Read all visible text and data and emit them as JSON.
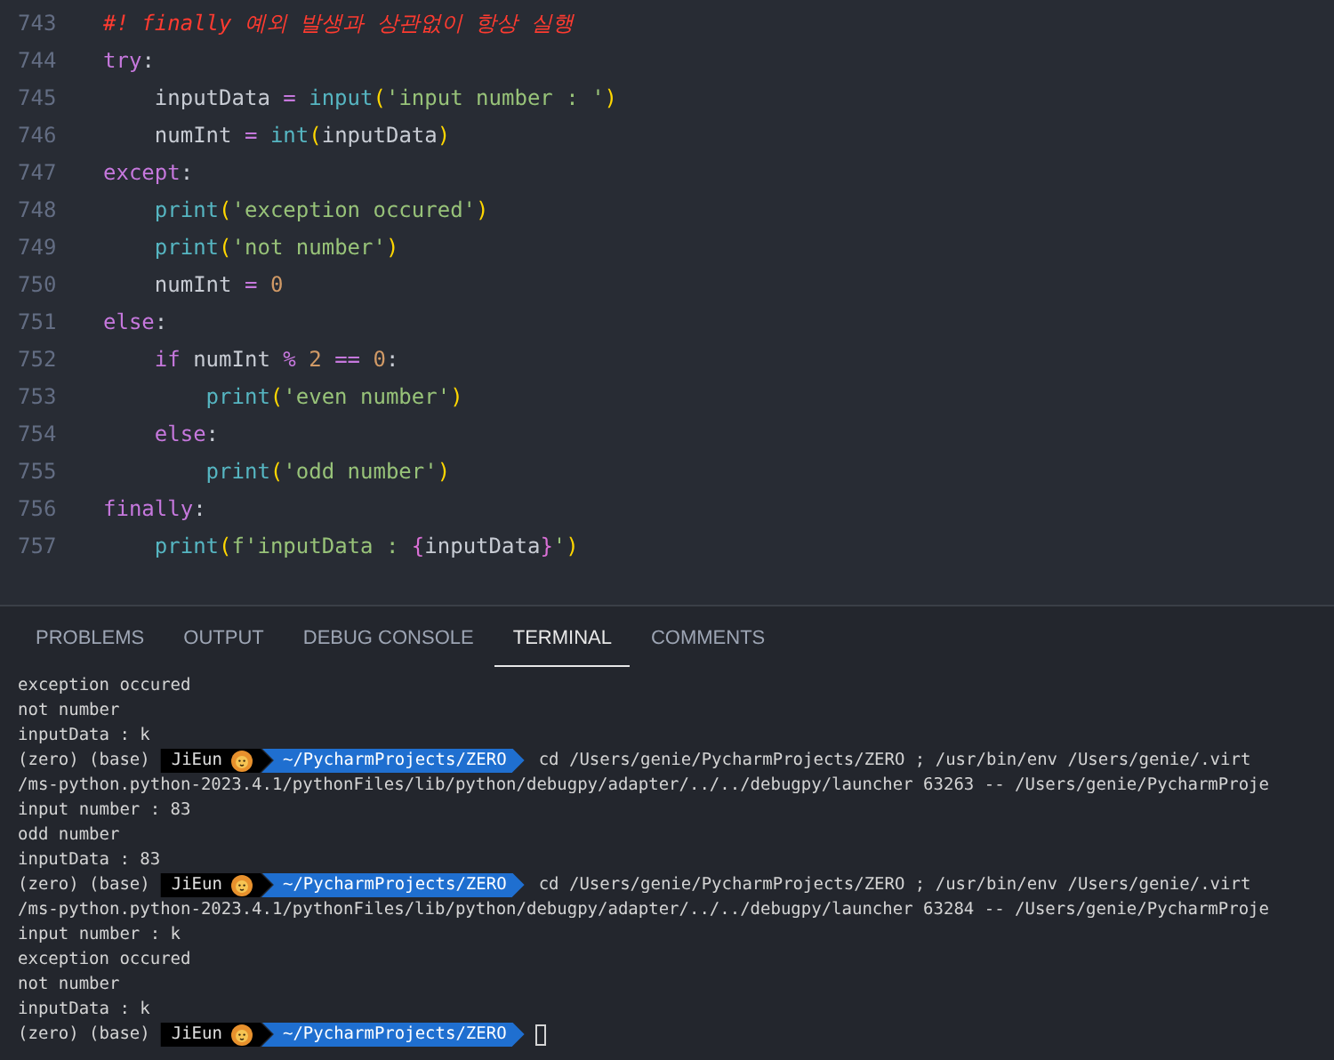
{
  "editor": {
    "lines": [
      {
        "number": "743",
        "tokens": [
          {
            "kind": "comment",
            "text": "#! finally 예외 발생과 상관없이 항상 실행"
          }
        ]
      },
      {
        "number": "744",
        "tokens": [
          {
            "kind": "keyword",
            "text": "try"
          },
          {
            "kind": "plain",
            "text": ":"
          }
        ]
      },
      {
        "number": "745",
        "tokens": [
          {
            "kind": "plain",
            "text": "    inputData "
          },
          {
            "kind": "operator",
            "text": "= "
          },
          {
            "kind": "function",
            "text": "input"
          },
          {
            "kind": "paren",
            "text": "("
          },
          {
            "kind": "string",
            "text": "'input number : '"
          },
          {
            "kind": "paren",
            "text": ")"
          }
        ]
      },
      {
        "number": "746",
        "tokens": [
          {
            "kind": "plain",
            "text": "    numInt "
          },
          {
            "kind": "operator",
            "text": "= "
          },
          {
            "kind": "function",
            "text": "int"
          },
          {
            "kind": "paren",
            "text": "("
          },
          {
            "kind": "plain",
            "text": "inputData"
          },
          {
            "kind": "paren",
            "text": ")"
          }
        ]
      },
      {
        "number": "747",
        "tokens": [
          {
            "kind": "keyword",
            "text": "except"
          },
          {
            "kind": "plain",
            "text": ":"
          }
        ]
      },
      {
        "number": "748",
        "tokens": [
          {
            "kind": "function",
            "text": "    print"
          },
          {
            "kind": "paren",
            "text": "("
          },
          {
            "kind": "string",
            "text": "'exception occured'"
          },
          {
            "kind": "paren",
            "text": ")"
          }
        ]
      },
      {
        "number": "749",
        "tokens": [
          {
            "kind": "function",
            "text": "    print"
          },
          {
            "kind": "paren",
            "text": "("
          },
          {
            "kind": "string",
            "text": "'not number'"
          },
          {
            "kind": "paren",
            "text": ")"
          }
        ]
      },
      {
        "number": "750",
        "tokens": [
          {
            "kind": "plain",
            "text": "    numInt "
          },
          {
            "kind": "operator",
            "text": "= "
          },
          {
            "kind": "number",
            "text": "0"
          }
        ]
      },
      {
        "number": "751",
        "tokens": [
          {
            "kind": "keyword",
            "text": "else"
          },
          {
            "kind": "plain",
            "text": ":"
          }
        ]
      },
      {
        "number": "752",
        "tokens": [
          {
            "kind": "keyword",
            "text": "    if"
          },
          {
            "kind": "plain",
            "text": " numInt "
          },
          {
            "kind": "operator",
            "text": "% "
          },
          {
            "kind": "number",
            "text": "2 "
          },
          {
            "kind": "operator",
            "text": "== "
          },
          {
            "kind": "number",
            "text": "0"
          },
          {
            "kind": "plain",
            "text": ":"
          }
        ]
      },
      {
        "number": "753",
        "tokens": [
          {
            "kind": "function",
            "text": "        print"
          },
          {
            "kind": "paren",
            "text": "("
          },
          {
            "kind": "string",
            "text": "'even number'"
          },
          {
            "kind": "paren",
            "text": ")"
          }
        ]
      },
      {
        "number": "754",
        "tokens": [
          {
            "kind": "keyword",
            "text": "    else"
          },
          {
            "kind": "plain",
            "text": ":"
          }
        ]
      },
      {
        "number": "755",
        "tokens": [
          {
            "kind": "function",
            "text": "        print"
          },
          {
            "kind": "paren",
            "text": "("
          },
          {
            "kind": "string",
            "text": "'odd number'"
          },
          {
            "kind": "paren",
            "text": ")"
          }
        ]
      },
      {
        "number": "756",
        "tokens": [
          {
            "kind": "keyword",
            "text": "finally"
          },
          {
            "kind": "plain",
            "text": ":"
          }
        ]
      },
      {
        "number": "757",
        "tokens": [
          {
            "kind": "function",
            "text": "    print"
          },
          {
            "kind": "paren",
            "text": "("
          },
          {
            "kind": "string",
            "text": "f'inputData : "
          },
          {
            "kind": "brace",
            "text": "{"
          },
          {
            "kind": "plain",
            "text": "inputData"
          },
          {
            "kind": "brace",
            "text": "}"
          },
          {
            "kind": "string",
            "text": "'"
          },
          {
            "kind": "paren",
            "text": ")"
          }
        ]
      }
    ]
  },
  "panel": {
    "tabs": [
      {
        "label": "PROBLEMS",
        "selected": false
      },
      {
        "label": "OUTPUT",
        "selected": false
      },
      {
        "label": "DEBUG CONSOLE",
        "selected": false
      },
      {
        "label": "TERMINAL",
        "selected": true
      },
      {
        "label": "COMMENTS",
        "selected": false
      }
    ]
  },
  "terminal": {
    "lines": [
      {
        "kind": "output",
        "text": "exception occured"
      },
      {
        "kind": "output",
        "text": "not number"
      },
      {
        "kind": "output",
        "text": "inputData : k"
      },
      {
        "kind": "prompt",
        "env": "(zero) (base)",
        "user": "JiEun",
        "path": "~/PycharmProjects/ZERO",
        "command": "cd /Users/genie/PycharmProjects/ZERO ; /usr/bin/env /Users/genie/.virt"
      },
      {
        "kind": "output",
        "text": "/ms-python.python-2023.4.1/pythonFiles/lib/python/debugpy/adapter/../../debugpy/launcher 63263 -- /Users/genie/PycharmProje"
      },
      {
        "kind": "output",
        "text": "input number : 83"
      },
      {
        "kind": "output",
        "text": "odd number"
      },
      {
        "kind": "output",
        "text": "inputData : 83"
      },
      {
        "kind": "prompt",
        "env": "(zero) (base)",
        "user": "JiEun",
        "path": "~/PycharmProjects/ZERO",
        "command": "cd /Users/genie/PycharmProjects/ZERO ; /usr/bin/env /Users/genie/.virt"
      },
      {
        "kind": "output",
        "text": "/ms-python.python-2023.4.1/pythonFiles/lib/python/debugpy/adapter/../../debugpy/launcher 63284 -- /Users/genie/PycharmProje"
      },
      {
        "kind": "output",
        "text": "input number : k"
      },
      {
        "kind": "output",
        "text": "exception occured"
      },
      {
        "kind": "output",
        "text": "not number"
      },
      {
        "kind": "output",
        "text": "inputData : k"
      },
      {
        "kind": "prompt",
        "env": "(zero) (base)",
        "user": "JiEun",
        "path": "~/PycharmProjects/ZERO",
        "cursor": true
      }
    ]
  }
}
